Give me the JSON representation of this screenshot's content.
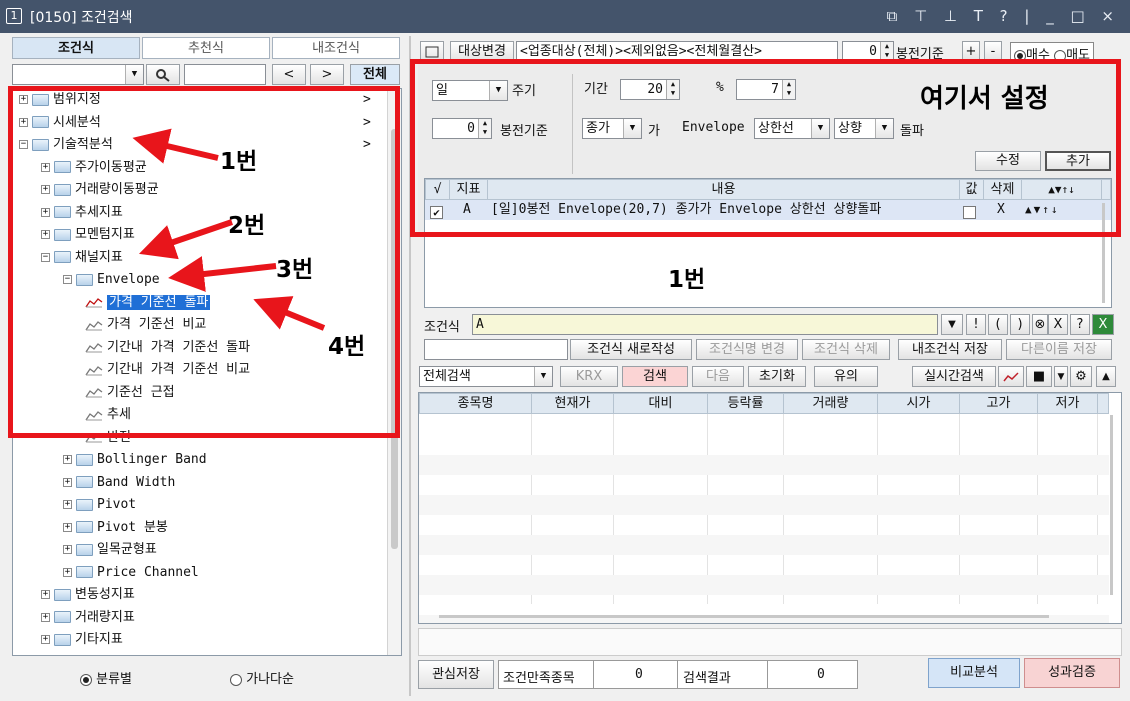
{
  "window": {
    "icon_label": "1",
    "title": "[0150] 조건검색",
    "controls": "⧉ ⊤ ⊥ T ? | _ □ ×"
  },
  "left": {
    "tabs": [
      "조건식",
      "추천식",
      "내조건식"
    ],
    "search_buttons": {
      "prev": "<",
      "next": ">",
      "all": "전체"
    },
    "tree": [
      {
        "label": "범위지정",
        "level": 0,
        "type": "folder",
        "arrow": ">"
      },
      {
        "label": "시세분석",
        "level": 0,
        "type": "folder",
        "arrow": ">"
      },
      {
        "label": "기술적분석",
        "level": 0,
        "type": "folder",
        "arrow": ">",
        "expanded": true
      },
      {
        "label": "주가이동평균",
        "level": 1,
        "type": "folder"
      },
      {
        "label": "거래량이동평균",
        "level": 1,
        "type": "folder"
      },
      {
        "label": "추세지표",
        "level": 1,
        "type": "folder"
      },
      {
        "label": "모멘텀지표",
        "level": 1,
        "type": "folder"
      },
      {
        "label": "채널지표",
        "level": 1,
        "type": "folder",
        "expanded": true
      },
      {
        "label": "Envelope",
        "level": 2,
        "type": "folder",
        "expanded": true
      },
      {
        "label": "가격 기준선 돌파",
        "level": 3,
        "type": "indicator",
        "selected": true
      },
      {
        "label": "가격 기준선 비교",
        "level": 3,
        "type": "indicator"
      },
      {
        "label": "기간내 가격 기준선 돌파",
        "level": 3,
        "type": "indicator"
      },
      {
        "label": "기간내 가격 기준선 비교",
        "level": 3,
        "type": "indicator"
      },
      {
        "label": "기준선 근접",
        "level": 3,
        "type": "indicator"
      },
      {
        "label": "추세",
        "level": 3,
        "type": "indicator"
      },
      {
        "label": "반전",
        "level": 3,
        "type": "indicator"
      },
      {
        "label": "Bollinger Band",
        "level": 2,
        "type": "folder"
      },
      {
        "label": "Band Width",
        "level": 2,
        "type": "folder"
      },
      {
        "label": "Pivot",
        "level": 2,
        "type": "folder"
      },
      {
        "label": "Pivot 분봉",
        "level": 2,
        "type": "folder"
      },
      {
        "label": "일목균형표",
        "level": 2,
        "type": "folder"
      },
      {
        "label": "Price Channel",
        "level": 2,
        "type": "folder"
      },
      {
        "label": "변동성지표",
        "level": 1,
        "type": "folder"
      },
      {
        "label": "거래량지표",
        "level": 1,
        "type": "folder"
      },
      {
        "label": "기타지표",
        "level": 1,
        "type": "folder"
      }
    ],
    "sort_options": {
      "by_category": "분류별",
      "by_alpha": "가나다순"
    }
  },
  "right": {
    "top": {
      "target_btn": "대상변경",
      "target_text": "<업종대상(전체)><제외없음><전체월결산>",
      "bar_count": "0",
      "bar_label": "봉전기준",
      "plus": "+",
      "minus": "-",
      "buy": "매수",
      "sell": "매도"
    },
    "settings": {
      "period_type": "일",
      "period_label": "주기",
      "bars_value": "0",
      "bars_label": "봉전기준",
      "term_label": "기간",
      "term_value": "20",
      "pct_label": "%",
      "pct_value": "7",
      "price_type": "종가",
      "ga": "가",
      "indicator": "Envelope",
      "line": "상한선",
      "direction": "상향",
      "cross": "돌파",
      "modify_btn": "수정",
      "add_btn": "추가"
    },
    "condition_table": {
      "headers": {
        "check": "√",
        "index": "지표",
        "content": "내용",
        "value": "값",
        "delete": "삭제"
      },
      "rows": [
        {
          "checked": true,
          "index": "A",
          "content": "[일]0봉전 Envelope(20,7) 종가가 Envelope 상한선 상향돌파",
          "delete": "X"
        }
      ]
    },
    "formula": {
      "label": "조건식",
      "value": "A",
      "buttons": [
        "!",
        "(",
        ")",
        "⊗",
        "X",
        "?"
      ]
    },
    "action_buttons": [
      "조건식 새로작성",
      "조건식명 변경",
      "조건식 삭제",
      "내조건식 저장",
      "다른이름 저장"
    ],
    "search_bar": {
      "scope": "전체검색",
      "krx": "KRX",
      "search": "검색",
      "next": "다음",
      "reset": "초기화",
      "caution": "유의",
      "realtime": "실시간검색"
    },
    "result_headers": [
      "종목명",
      "현재가",
      "대비",
      "등락률",
      "거래량",
      "시가",
      "고가",
      "저가"
    ],
    "bottom": {
      "save_watch": "관심저장",
      "matched_label": "조건만족종목",
      "matched_value": "0",
      "result_label": "검색결과",
      "result_value": "0",
      "compare": "비교분석",
      "perf": "성과검증"
    }
  },
  "annotations": {
    "setting_here": "여기서 설정",
    "step1": "1번",
    "step2": "2번",
    "step3": "3번",
    "step4": "4번",
    "step1_bottom": "1번",
    "color": "#e8151b"
  }
}
